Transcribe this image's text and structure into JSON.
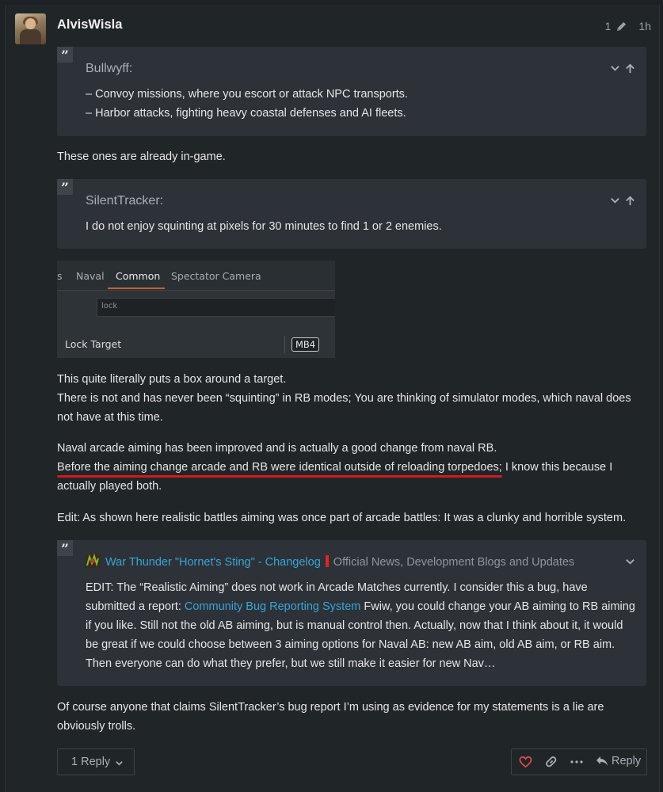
{
  "post": {
    "username": "AlvisWisla",
    "edit_count": "1",
    "age": "1h",
    "colors": {
      "link": "#3aa3d8",
      "underline": "#d01c1c",
      "like": "#e04b4b"
    }
  },
  "quote1": {
    "author": "Bullwyff:",
    "lines": [
      "– Convoy missions, where you escort or attack NPC transports.",
      "– Harbor attacks, fighting heavy coastal defenses and AI fleets."
    ]
  },
  "para1": "These ones are already in-game.",
  "quote2": {
    "author": "SilentTracker:",
    "lines": [
      "I do not enjoy squinting at pixels for 30 minutes to find 1 or 2 enemies."
    ]
  },
  "screenshot": {
    "tabs": [
      "s",
      "Naval",
      "Common",
      "Spectator Camera"
    ],
    "active_tab": "Common",
    "search_value": "lock",
    "row_label": "Lock Target",
    "key_badge": "MB4"
  },
  "para2": [
    "This quite literally puts a box around a target.",
    "There is not and has never been “squinting” in RB modes; You are thinking of simulator modes, which naval does",
    "not have at this time."
  ],
  "para3": [
    "Naval arcade aiming has been improved and is actually a good change from naval RB.",
    "Before the aiming change arcade and RB were identical outside of reloading torpedoes; I know this because I",
    "actually played both."
  ],
  "para4": "Edit: As shown here realistic battles aiming was once part of arcade battles: It was a clunky and horrible system.",
  "onebox": {
    "topic_title": "War Thunder \"Hornet's Sting\" - Changelog",
    "category": "Official News, Development Blogs and Updates",
    "line1": "EDIT: The “Realistic Aiming” does not work in Arcade Matches currently. I consider this a bug, have",
    "line2_pre": "submitted a report: ",
    "line2_link": "Community Bug Reporting System",
    "line2_post": " Fwiw, you could change your AB aiming to RB aiming",
    "line3": "if you like. Still not the old AB aiming, but is manual control then. Actually, now that I think about it, it would",
    "line4": "be great if we could choose between 3 aiming options for Naval AB: new AB aim, old AB aim, or RB aim.",
    "line5": "Then everyone can do what they prefer, but we still make it easier for new Nav…"
  },
  "para5": [
    "Of course anyone that claims SilentTracker’s bug report I’m using as evidence for my statements is a lie are",
    "obviously trolls."
  ],
  "footer": {
    "replies_label": "1 Reply",
    "reply_label": "Reply"
  }
}
